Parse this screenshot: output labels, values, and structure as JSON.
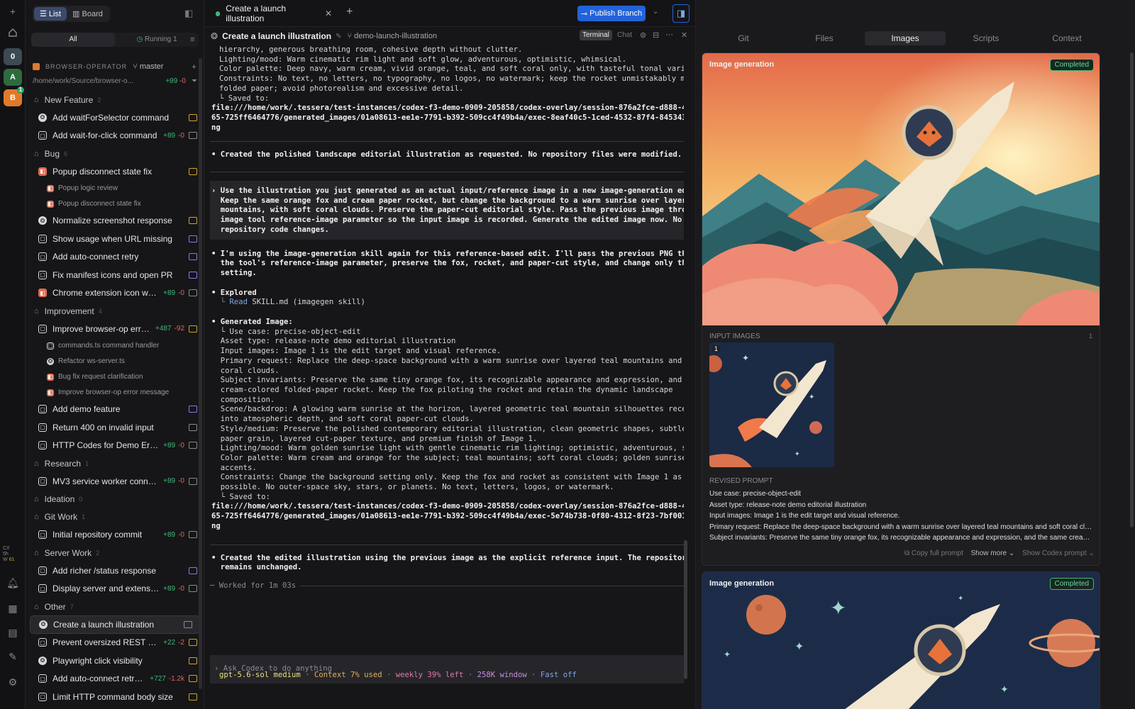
{
  "rail": {
    "workspaces": [
      "0",
      "A",
      "B"
    ],
    "active_badge": "1",
    "usage": [
      "CX",
      "5h",
      "W"
    ],
    "usage_value": "61"
  },
  "sidebar": {
    "view_list": "List",
    "view_board": "Board",
    "tabs": [
      "All",
      "Running 1"
    ],
    "project": "BROWSER-OPERATOR",
    "branch": "master",
    "path": "/home/work/Source/browser-o...",
    "path_add": "+89",
    "path_del": "-0",
    "rows": [
      {
        "k": "g",
        "label": "New Feature",
        "count": "2"
      },
      {
        "k": "i",
        "icon": "g",
        "label": "Add waitForSelector command",
        "st": "y"
      },
      {
        "k": "i",
        "icon": "w",
        "label": "Add wait-for-click command",
        "add": "+89",
        "del": "-0",
        "st": "c"
      },
      {
        "k": "g",
        "label": "Bug",
        "count": "6"
      },
      {
        "k": "i",
        "icon": "o",
        "label": "Popup disconnect state fix",
        "st": "y"
      },
      {
        "k": "s",
        "icon": "o",
        "label": "Popup logic review"
      },
      {
        "k": "s",
        "icon": "o",
        "label": "Popup disconnect state fix"
      },
      {
        "k": "i",
        "icon": "g",
        "label": "Normalize screenshot response",
        "st": "y"
      },
      {
        "k": "i",
        "icon": "w",
        "label": "Show usage when URL missing",
        "st": "p"
      },
      {
        "k": "i",
        "icon": "w",
        "label": "Add auto-connect retry",
        "st": "p"
      },
      {
        "k": "i",
        "icon": "w",
        "label": "Fix manifest icons and open PR",
        "st": "p"
      },
      {
        "k": "i",
        "icon": "o",
        "label": "Chrome extension icon warn...",
        "add": "+89",
        "del": "-0",
        "st": "c"
      },
      {
        "k": "g",
        "label": "Improvement",
        "count": "4"
      },
      {
        "k": "i",
        "icon": "w",
        "label": "Improve browser-op error ...",
        "add": "+487",
        "del": "-92",
        "st": "y"
      },
      {
        "k": "s",
        "icon": "w",
        "label": "commands.ts command handler"
      },
      {
        "k": "s",
        "icon": "g",
        "label": "Refactor ws-server.ts"
      },
      {
        "k": "s",
        "icon": "o",
        "label": "Bug fix request clarification"
      },
      {
        "k": "s",
        "icon": "o",
        "label": "Improve browser-op error message"
      },
      {
        "k": "i",
        "icon": "w",
        "label": "Add demo feature",
        "st": "p"
      },
      {
        "k": "i",
        "icon": "w",
        "label": "Return 400 on invalid input",
        "st": "c"
      },
      {
        "k": "i",
        "icon": "w",
        "label": "HTTP Codes for Demo Errors",
        "add": "+89",
        "del": "-0",
        "st": "c"
      },
      {
        "k": "g",
        "label": "Research",
        "count": "1"
      },
      {
        "k": "i",
        "icon": "w",
        "label": "MV3 service worker connecti...",
        "add": "+89",
        "del": "-0",
        "st": "c"
      },
      {
        "k": "g",
        "label": "Ideation",
        "count": "0"
      },
      {
        "k": "g",
        "label": "Git Work",
        "count": "1"
      },
      {
        "k": "i",
        "icon": "w",
        "label": "Initial repository commit",
        "add": "+89",
        "del": "-0",
        "st": "c"
      },
      {
        "k": "g",
        "label": "Server Work",
        "count": "2"
      },
      {
        "k": "i",
        "icon": "w",
        "label": "Add richer /status response",
        "st": "p"
      },
      {
        "k": "i",
        "icon": "w",
        "label": "Display server and extension...",
        "add": "+89",
        "del": "-0",
        "st": "c"
      },
      {
        "k": "g",
        "label": "Other",
        "count": "7"
      },
      {
        "k": "i",
        "icon": "g",
        "label": "Create a launch illustration",
        "st": "c",
        "sel": true
      },
      {
        "k": "i",
        "icon": "w",
        "label": "Prevent oversized REST payl...",
        "add": "+22",
        "del": "-2",
        "st": "y"
      },
      {
        "k": "i",
        "icon": "g",
        "label": "Playwright click visibility",
        "st": "y"
      },
      {
        "k": "i",
        "icon": "w",
        "label": "Add auto-connect retry l...",
        "add": "+727",
        "del": "-1.2k",
        "st": "y"
      },
      {
        "k": "i",
        "icon": "w",
        "label": "Limit HTTP command body size",
        "st": "y"
      }
    ]
  },
  "topbar": {
    "tab_title": "Create a launch illustration",
    "publish": "Publish Branch"
  },
  "session": {
    "title": "Create a launch illustration",
    "branch": "demo-launch-illustration",
    "mode_terminal": "Terminal",
    "mode_chat": "Chat"
  },
  "transcript": {
    "top": [
      "hierarchy, generous breathing room, cohesive depth without clutter.",
      "Lighting/mood: Warm cinematic rim light and soft glow, adventurous, optimistic, whimsical.",
      "Color palette: Deep navy, warm cream, vivid orange, teal, and soft coral only, with tasteful tonal variation.",
      "Constraints: No text, no letters, no typography, no logos, no watermark; keep the rocket unmistakably made of",
      "folded paper; avoid photorealism and excessive detail.",
      "└ Saved to:"
    ],
    "saved1": [
      "file:///home/work/.tessera/test-instances/codex-f3-demo-0909-205858/codex-overlay/session-876a2fce-d888-4cdd-aa",
      "65-725ff6464776/generated_images/01a08613-ee1e-7791-b392-509cc4f49b4a/exec-8eaf40c5-1ced-4532-87f4-845343a6c9a2.p",
      "ng"
    ],
    "done1": "• Created the polished landscape editorial illustration as requested. No repository files were modified.",
    "user": [
      "› Use the illustration you just generated as an actual input/reference image in a new image-generation edit.",
      "  Keep the same orange fox and cream paper rocket, but change the background to a warm sunrise over layered teal",
      "  mountains, with soft coral clouds. Preserve the paper-cut editorial style. Pass the previous image through the",
      "  image tool reference-image parameter so the input image is recorded. Generate the edited image now. No",
      "  repository code changes."
    ],
    "plan": [
      "• I'm using the image-generation skill again for this reference-based edit. I'll pass the previous PNG through",
      "  the tool's reference-image parameter, preserve the fox, rocket, and paper-cut style, and change only the",
      "  setting."
    ],
    "explored": "• Explored",
    "read_prefix": "  └ ",
    "read": "Read",
    "read_rest": " SKILL.md (imagegen skill)",
    "gen": "• Generated Image:",
    "gen_lines": [
      "  └ Use case: precise-object-edit",
      "  Asset type: release-note demo editorial illustration",
      "  Input images: Image 1 is the edit target and visual reference.",
      "  Primary request: Replace the deep-space background with a warm sunrise over layered teal mountains and soft",
      "  coral clouds.",
      "  Subject invariants: Preserve the same tiny orange fox, its recognizable appearance and expression, and the same",
      "  cream-colored folded-paper rocket. Keep the fox piloting the rocket and retain the dynamic landscape",
      "  composition.",
      "  Scene/backdrop: A glowing warm sunrise at the horizon, layered geometric teal mountain silhouettes receding",
      "  into atmospheric depth, and soft coral paper-cut clouds.",
      "  Style/medium: Preserve the polished contemporary editorial illustration, clean geometric shapes, subtle tactile",
      "  paper grain, layered cut-paper texture, and premium finish of Image 1.",
      "  Lighting/mood: Warm golden sunrise light with gentle cinematic rim lighting; optimistic, adventurous, serene.",
      "  Color palette: Warm cream and orange for the subject; teal mountains; soft coral clouds; golden sunrise",
      "  accents.",
      "  Constraints: Change the background setting only. Keep the fox and rocket as consistent with Image 1 as",
      "  possible. No outer-space sky, stars, or planets. No text, letters, logos, or watermark.",
      "  └ Saved to:"
    ],
    "saved2": [
      "file:///home/work/.tessera/test-instances/codex-f3-demo-0909-205858/codex-overlay/session-876a2fce-d888-4cdd-aa",
      "65-725ff6464776/generated_images/01a08613-ee1e-7791-b392-509cc4f49b4a/exec-5e74b738-0f80-4312-8f23-7bf001e75a34.p",
      "ng"
    ],
    "done2": [
      "• Created the edited illustration using the previous image as the explicit reference input. The repository",
      "  remains unchanged."
    ],
    "worked": "─ Worked for 1m 03s",
    "input_placeholder": "› Ask Codex to do anything",
    "status": {
      "model": "gpt-5.6-sol medium",
      "sep": " · ",
      "ctx": "Context 7% used",
      "weekly": "weekly 39% left",
      "win": "258K window",
      "fast": "Fast off"
    }
  },
  "right": {
    "tabs": [
      "Git",
      "Files",
      "Images",
      "Scripts",
      "Context"
    ],
    "card1": {
      "title": "Image generation",
      "status": "Completed"
    },
    "input_label": "INPUT IMAGES",
    "input_count": "1",
    "thumb_index": "1",
    "revised_label": "REVISED PROMPT",
    "revised": [
      "Use case: precise-object-edit",
      "Asset type: release-note demo editorial illustration",
      "Input images: Image 1 is the edit target and visual reference.",
      "Primary request: Replace the deep-space background with a warm sunrise over layered teal mountains and soft coral clouds.",
      "Subject invariants: Preserve the same tiny orange fox, its recognizable appearance and expression, and the same cream-colore..."
    ],
    "copy": "Copy full prompt",
    "show_more": "Show more",
    "show_codex": "Show Codex prompt",
    "card2": {
      "title": "Image generation",
      "status": "Completed"
    }
  },
  "colors": {
    "accent": "#2363d9",
    "success": "#3fb87a",
    "danger": "#e0675a",
    "warn": "#d4a326"
  }
}
